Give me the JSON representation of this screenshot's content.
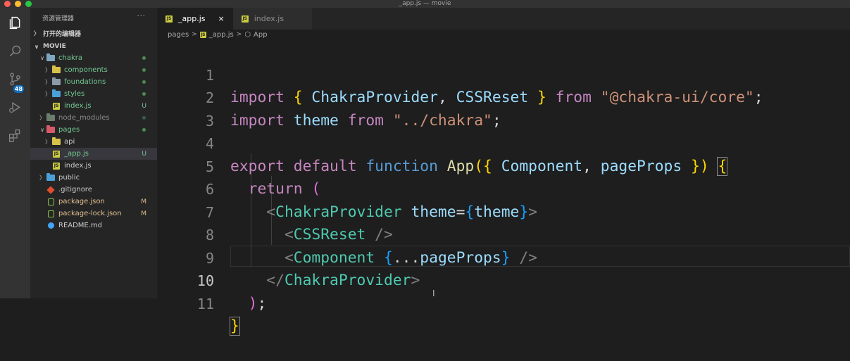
{
  "window": {
    "title": "_app.js — movie"
  },
  "activity_bar": {
    "icons": [
      "explorer-icon",
      "search-icon",
      "source-control-icon",
      "run-debug-icon",
      "extensions-icon"
    ],
    "scm_badge": "48"
  },
  "sidebar": {
    "header": "资源管理器",
    "more": "···",
    "open_editors": "打开的编辑器",
    "project": "MOVIE",
    "items": [
      {
        "label": "chakra",
        "status": "",
        "dot": true
      },
      {
        "label": "components",
        "status": "",
        "dot": true
      },
      {
        "label": "foundations",
        "status": "",
        "dot": true
      },
      {
        "label": "styles",
        "status": "",
        "dot": true
      },
      {
        "label": "index.js",
        "status": "U"
      },
      {
        "label": "node_modules",
        "status": "",
        "dot": true
      },
      {
        "label": "pages",
        "status": "",
        "dot": true
      },
      {
        "label": "api",
        "status": ""
      },
      {
        "label": "_app.js",
        "status": "U"
      },
      {
        "label": "index.js",
        "status": ""
      },
      {
        "label": "public",
        "status": ""
      },
      {
        "label": ".gitignore",
        "status": ""
      },
      {
        "label": "package.json",
        "status": "M"
      },
      {
        "label": "package-lock.json",
        "status": "M"
      },
      {
        "label": "README.md",
        "status": ""
      }
    ]
  },
  "tabs": [
    {
      "label": "_app.js",
      "close": "×"
    },
    {
      "label": "index.js"
    }
  ],
  "breadcrumb": {
    "parts": [
      "pages",
      "_app.js",
      "App"
    ],
    "sep": ">"
  },
  "editor": {
    "line_numbers": [
      "1",
      "2",
      "3",
      "4",
      "5",
      "6",
      "7",
      "8",
      "9",
      "10",
      "11"
    ],
    "tokens": {
      "import": "import",
      "open_brace": "{ ",
      "chakra_provider": "ChakraProvider",
      "comma": ", ",
      "css_reset": "CSSReset",
      "close_brace": " }",
      "from": "from",
      "core_pkg": "\"@chakra-ui/core\"",
      "semi": ";",
      "theme": "theme",
      "theme_path": "\"../chakra\"",
      "export": "export",
      "default": "default",
      "function": "function",
      "app": "App",
      "params_open": "({ ",
      "component": "Component",
      "page_props": "pageProps",
      "params_close": " })",
      "body_open": "{",
      "return": "return",
      "paren_open": "(",
      "lt": "<",
      "gt": ">",
      "eq": "=",
      "jsx_open": "{",
      "jsx_close": "}",
      "self_close": " />",
      "spread": "...",
      "close_tag": "</",
      "paren_close": ")",
      "body_close": "}"
    }
  }
}
